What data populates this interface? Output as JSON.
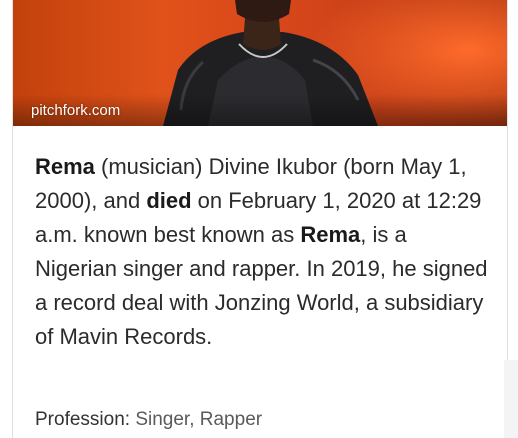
{
  "knowledge_panel": {
    "image": {
      "source_label": "pitchfork.com"
    },
    "description": {
      "part1_bold": "Rema",
      "part2": " (musician) Divine Ikubor (born May 1, 2000), and ",
      "part3_bold": "died",
      "part4": " on February 1, 2020 at 12:29 a.m. known best known as ",
      "part5_bold": "Rema",
      "part6": ", is a Nigerian singer and rapper. In 2019, he signed a record deal with Jonzing World, a subsidiary of Mavin Records."
    },
    "profession": {
      "label": "Profession: ",
      "value1": "Singer",
      "separator": ", ",
      "value2": "Rapper"
    }
  },
  "colors": {
    "hero_orange": "#e0521a",
    "text": "#2b2b2b"
  }
}
